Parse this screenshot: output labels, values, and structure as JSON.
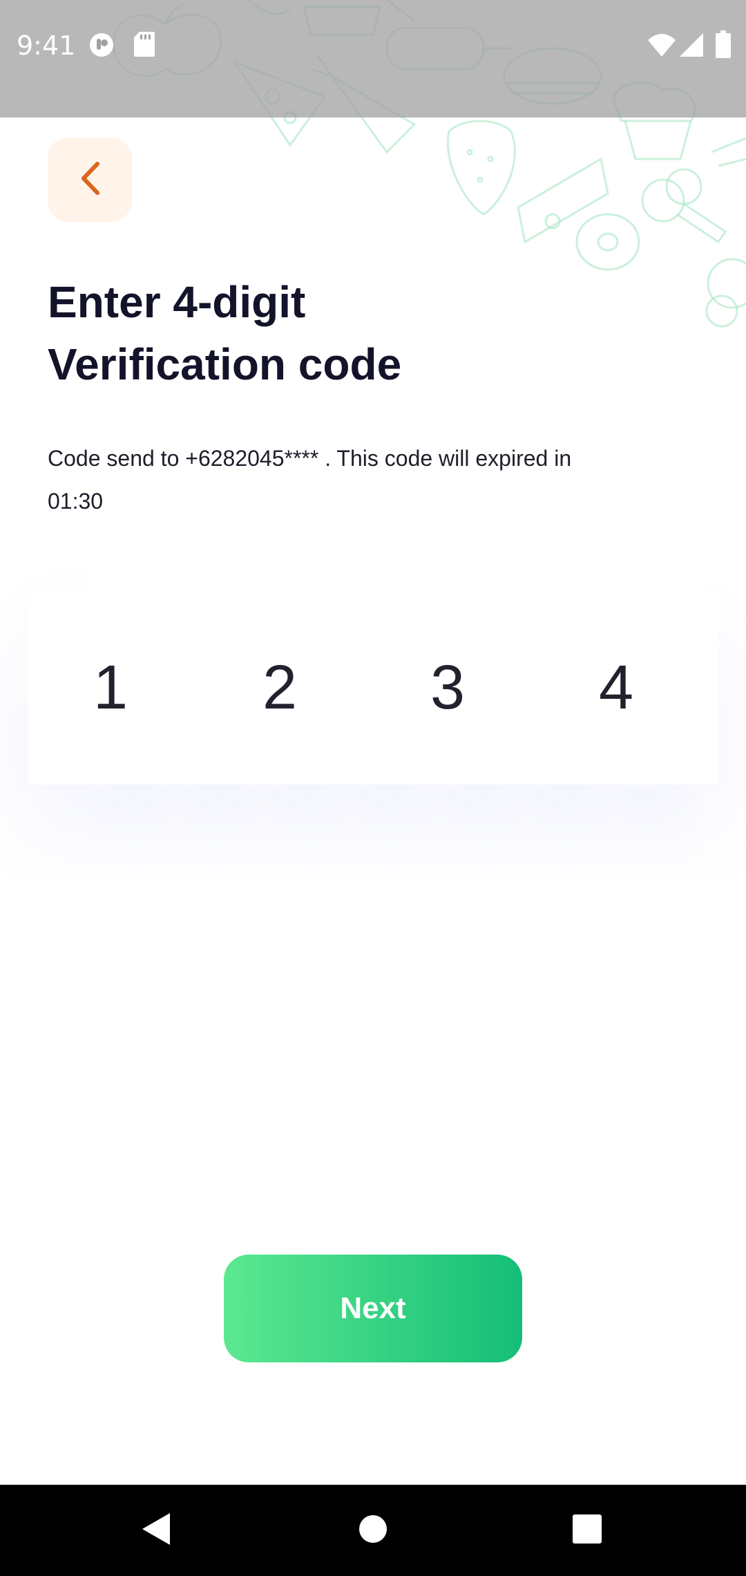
{
  "status_bar": {
    "time": "9:41",
    "left_icons": [
      "notification-app-icon",
      "sd-card-icon"
    ],
    "right_icons": [
      "wifi-icon",
      "cellular-signal-icon",
      "battery-icon"
    ]
  },
  "header": {
    "back_icon": "chevron-left-icon",
    "accent_color": "#d9671e"
  },
  "title": {
    "line1": "Enter 4-digit",
    "line2": "Verification code"
  },
  "subtitle": "Code send to +6282045**** . This code will expired in 01:30",
  "code": {
    "digits": [
      "1",
      "2",
      "3",
      "4"
    ]
  },
  "next_button": {
    "label": "Next",
    "gradient_start": "#5ce891",
    "gradient_end": "#15be77"
  },
  "nav_bar": {
    "icons": [
      "back-triangle-icon",
      "home-circle-icon",
      "recents-square-icon"
    ]
  }
}
